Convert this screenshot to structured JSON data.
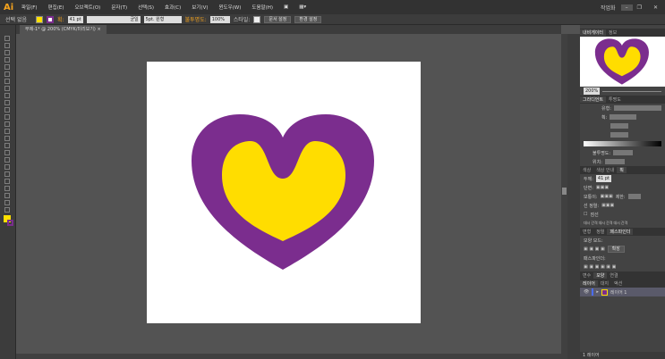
{
  "app": {
    "logo": "Ai",
    "workspace": "작업화",
    "menus": [
      "파일(F)",
      "편집(E)",
      "오브젝트(O)",
      "문자(T)",
      "선택(S)",
      "효과(C)",
      "보기(V)",
      "윈도우(W)",
      "도움말(H)"
    ]
  },
  "control": {
    "selection": "선택 없음",
    "stroke_label": "획:",
    "stroke_weight": "41 pt",
    "profile": "균일",
    "brush": "5pt. 원형",
    "opacity_label": "불투명도:",
    "opacity": "100%",
    "style_label": "스타일:",
    "doc_setup": "문서 설정",
    "prefs": "환경 설정",
    "fill_color": "#FFE000",
    "stroke_color": "#7B2D8E"
  },
  "document": {
    "tab": "무제-1* @ 200% (CMYK/미리보기)",
    "heart_outer_color": "#7B2D8E",
    "heart_inner_color": "#FFDD00"
  },
  "navigator": {
    "tabs": [
      "내비게이터",
      "정보"
    ],
    "zoom": "200%"
  },
  "gradient": {
    "tabs": [
      "그라디언트",
      "투명도"
    ],
    "type_label": "유형:",
    "stroke_label": "획:",
    "opacity_label": "불투명도:",
    "location_label": "위치:"
  },
  "stroke": {
    "tabs": [
      "색상",
      "색상 안내",
      "획"
    ],
    "weight_label": "두께:",
    "weight": "41 pt",
    "cap_label": "단면:",
    "corner_label": "모퉁이:",
    "limit_label": "제한:",
    "align_label": "선 정렬:",
    "dashed_label": "점선",
    "dash_labels": [
      "대시",
      "간격",
      "대시",
      "간격",
      "대시",
      "간격"
    ]
  },
  "pathfinder": {
    "tabs": [
      "변형",
      "정렬",
      "패스파인더"
    ],
    "shape_modes": "모양 모드:",
    "expand": "확장",
    "pathfinders": "패스파인더:"
  },
  "layers": {
    "top_tabs": [
      "변수",
      "모양",
      "연결"
    ],
    "tabs": [
      "레이어",
      "대지",
      "액션"
    ],
    "layer_name": "레이어 1",
    "footer": "1 레이어"
  }
}
